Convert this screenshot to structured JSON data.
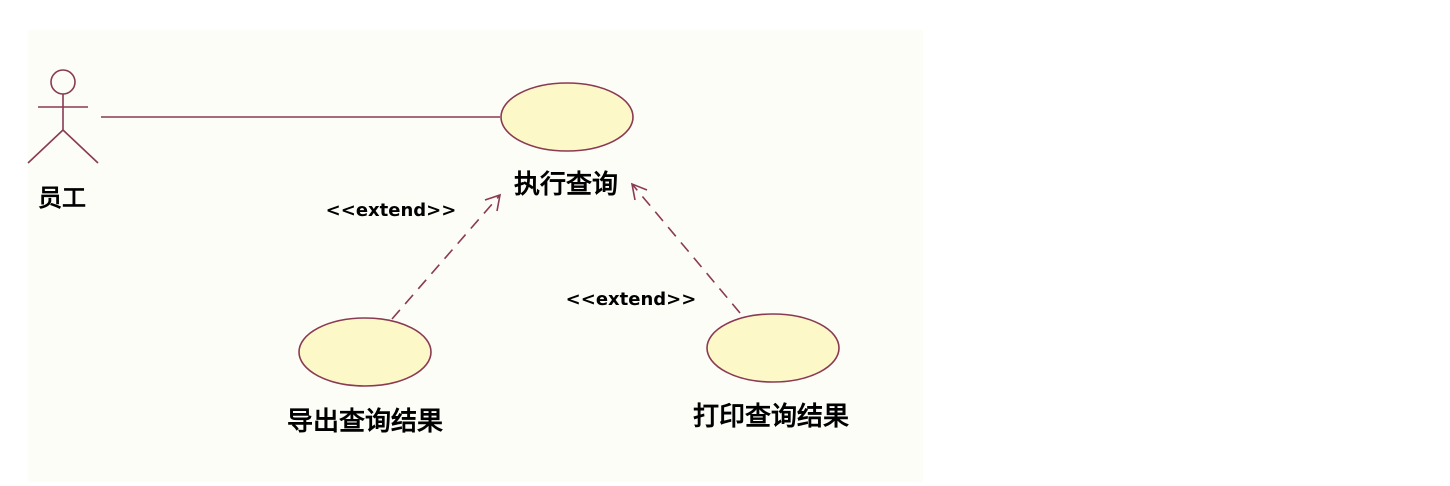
{
  "colors": {
    "line": "#8a3a52",
    "usecase_fill": "#fdf8c8",
    "background": "#fdfdf8"
  },
  "actors": [
    {
      "id": "employee",
      "label": "员工"
    }
  ],
  "use_cases": [
    {
      "id": "execute_query",
      "label": "执行查询"
    },
    {
      "id": "export_results",
      "label": "导出查询结果"
    },
    {
      "id": "print_results",
      "label": "打印查询结果"
    }
  ],
  "relationships": [
    {
      "from": "employee",
      "to": "execute_query",
      "type": "association"
    },
    {
      "from": "export_results",
      "to": "execute_query",
      "type": "extend",
      "label": "<<extend>>"
    },
    {
      "from": "print_results",
      "to": "execute_query",
      "type": "extend",
      "label": "<<extend>>"
    }
  ]
}
